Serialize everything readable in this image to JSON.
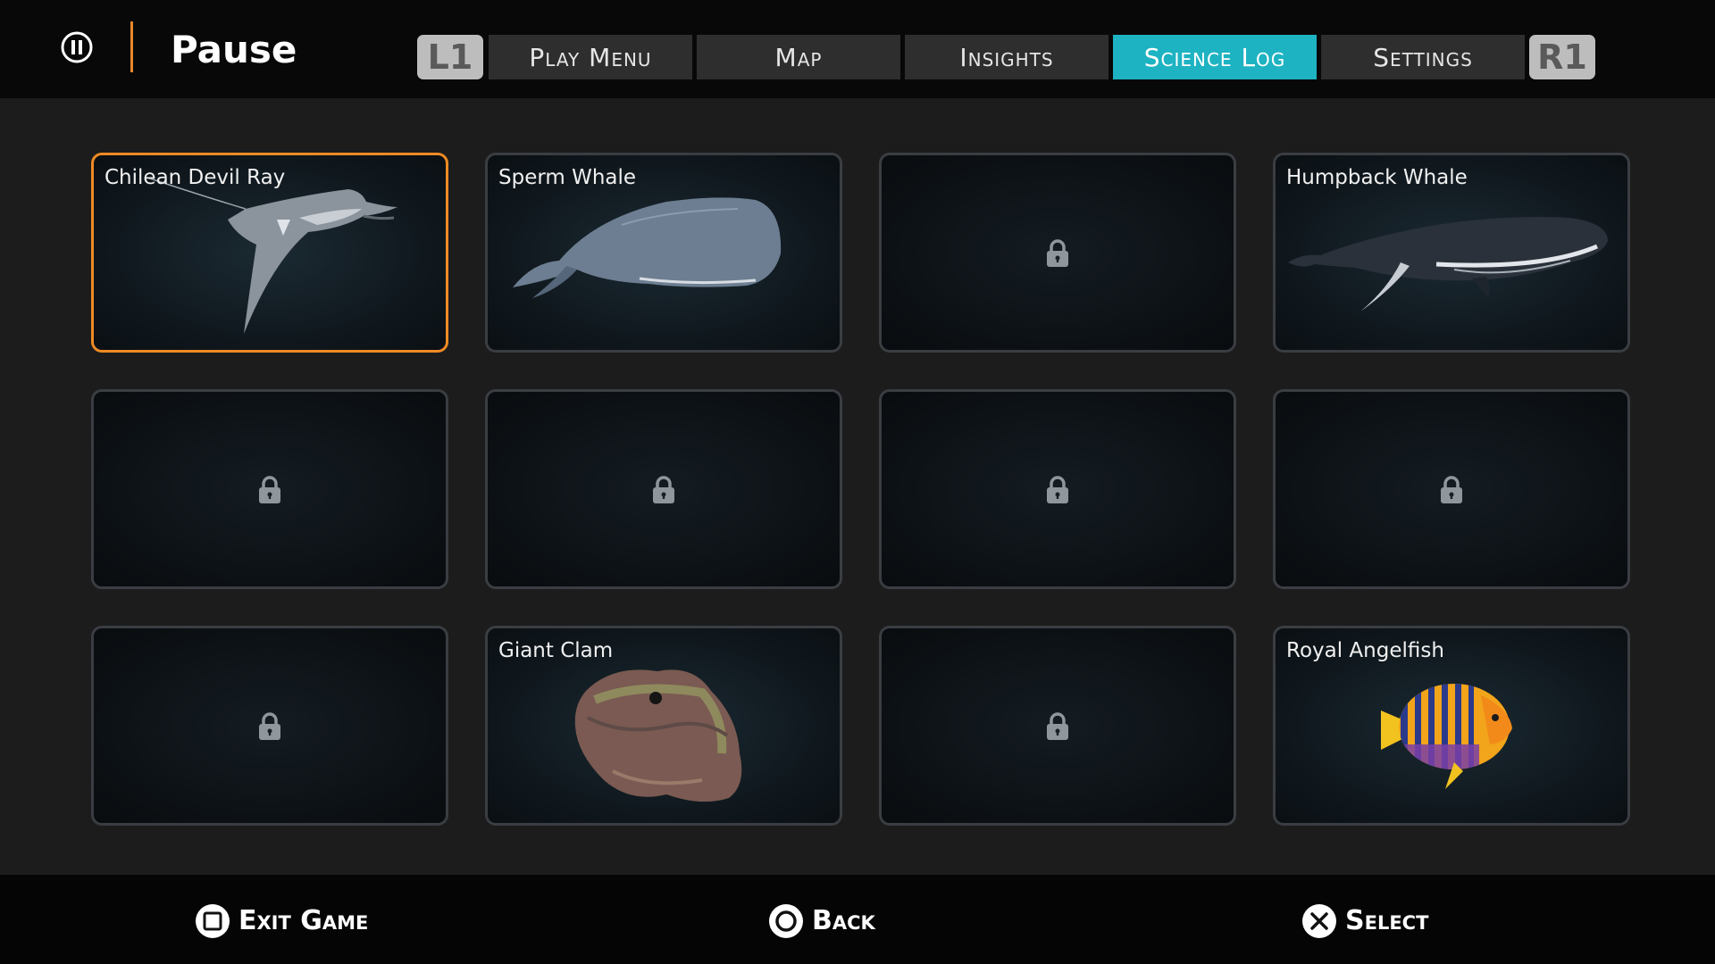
{
  "header": {
    "pause_icon": "pause-circle-icon",
    "title": "Pause",
    "left_bumper": "L1",
    "right_bumper": "R1",
    "tabs": [
      {
        "label": "Play Menu",
        "active": false
      },
      {
        "label": "Map",
        "active": false
      },
      {
        "label": "Insights",
        "active": false
      },
      {
        "label": "Science Log",
        "active": true
      },
      {
        "label": "Settings",
        "active": false
      }
    ]
  },
  "science_log": {
    "cards": [
      {
        "label": "Chilean Devil Ray",
        "locked": false,
        "selected": true,
        "image": "devil-ray"
      },
      {
        "label": "Sperm Whale",
        "locked": false,
        "selected": false,
        "image": "sperm-whale"
      },
      {
        "label": "",
        "locked": true,
        "selected": false,
        "image": "lock-icon"
      },
      {
        "label": "Humpback Whale",
        "locked": false,
        "selected": false,
        "image": "humpback-whale"
      },
      {
        "label": "",
        "locked": true,
        "selected": false,
        "image": "lock-icon"
      },
      {
        "label": "",
        "locked": true,
        "selected": false,
        "image": "lock-icon"
      },
      {
        "label": "",
        "locked": true,
        "selected": false,
        "image": "lock-icon"
      },
      {
        "label": "",
        "locked": true,
        "selected": false,
        "image": "lock-icon"
      },
      {
        "label": "",
        "locked": true,
        "selected": false,
        "image": "lock-icon"
      },
      {
        "label": "Giant Clam",
        "locked": false,
        "selected": false,
        "image": "giant-clam"
      },
      {
        "label": "",
        "locked": true,
        "selected": false,
        "image": "lock-icon"
      },
      {
        "label": "Royal Angelfish",
        "locked": false,
        "selected": false,
        "image": "royal-angelfish"
      }
    ]
  },
  "footer": {
    "prompts": [
      {
        "icon": "square-button-icon",
        "label": "Exit Game"
      },
      {
        "icon": "circle-button-icon",
        "label": "Back"
      },
      {
        "icon": "cross-button-icon",
        "label": "Select"
      }
    ]
  },
  "colors": {
    "accent_selected": "#ee8a24",
    "active_tab": "#1eb3c2",
    "title_divider": "#e8872a"
  }
}
